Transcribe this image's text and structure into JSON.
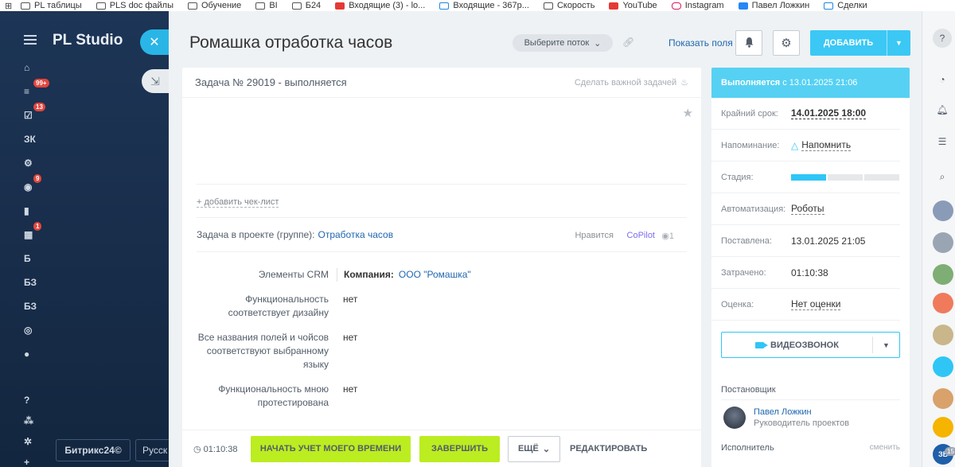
{
  "bookmarks": [
    {
      "label": "PL таблицы",
      "icon": "folder-icon"
    },
    {
      "label": "PLS doc файлы",
      "icon": "folder-icon"
    },
    {
      "label": "Обучение",
      "icon": "folder-icon"
    },
    {
      "label": "BI",
      "icon": "folder-icon"
    },
    {
      "label": "Б24",
      "icon": "folder-icon"
    },
    {
      "label": "Входящие (3) - lo...",
      "icon": "gmail-icon"
    },
    {
      "label": "Входящие - 367p...",
      "icon": "mail-icon"
    },
    {
      "label": "Скорость",
      "icon": "folder-icon"
    },
    {
      "label": "YouTube",
      "icon": "youtube-icon"
    },
    {
      "label": "Instagram",
      "icon": "instagram-icon"
    },
    {
      "label": "Павел Ложкин",
      "icon": "vk-icon"
    },
    {
      "label": "Сделки",
      "icon": "bitrix-icon"
    }
  ],
  "sidebar": {
    "brand": "PL Studio",
    "rail": [
      {
        "label": "",
        "icon": "home-icon"
      },
      {
        "label": "",
        "icon": "filter-icon",
        "badge": "99+"
      },
      {
        "label": "",
        "icon": "tasks-icon",
        "badge": "13"
      },
      {
        "label": "ЗК",
        "icon": ""
      },
      {
        "label": "",
        "icon": "crm-icon"
      },
      {
        "label": "",
        "icon": "robot-icon",
        "badge": "9"
      },
      {
        "label": "",
        "icon": "analytics-icon"
      },
      {
        "label": "",
        "icon": "store-icon",
        "badge": "1"
      },
      {
        "label": "Б",
        "icon": ""
      },
      {
        "label": "БЗ",
        "icon": ""
      },
      {
        "label": "БЗ",
        "icon": ""
      },
      {
        "label": "",
        "icon": "shield-icon"
      },
      {
        "label": "",
        "icon": "check-circle-icon"
      },
      {
        "label": "",
        "icon": ""
      },
      {
        "label": "",
        "icon": "help-icon"
      },
      {
        "label": "",
        "icon": "sitemap-icon"
      },
      {
        "label": "",
        "icon": "settings-icon"
      },
      {
        "label": "",
        "icon": "plus-icon"
      }
    ],
    "bitrix_label": "Битрикс24",
    "lang_label": "Русск"
  },
  "header": {
    "title": "Ромашка отработка часов",
    "flow_select": "Выберите поток",
    "show_fields": "Показать поля",
    "add_label": "ДОБАВИТЬ"
  },
  "task": {
    "title": "Задача № 29019 - выполняется",
    "important": "Сделать важной задачей",
    "checklist": "+ добавить чек-лист",
    "project_label": "Задача в проекте (группе):",
    "project_link": "Отработка часов",
    "likes": "Нравится",
    "copilot": "CoPilot",
    "views": "1"
  },
  "fields": [
    {
      "label": "Элементы CRM",
      "value_prefix": "Компания:",
      "value": "ООО \"Ромашка\""
    },
    {
      "label": "Функциональность соответствует дизайну",
      "value": "нет"
    },
    {
      "label": "Все названия полей и чойсов соответствуют выбранному языку",
      "value": "нет"
    },
    {
      "label": "Функциональность мною протестирована",
      "value": "нет"
    }
  ],
  "bottombar": {
    "timer": "01:10:38",
    "start": "НАЧАТЬ УЧЕТ МОЕГО ВРЕМЕНИ",
    "finish": "ЗАВЕРШИТЬ",
    "more": "ЕЩЁ",
    "edit": "РЕДАКТИРОВАТЬ"
  },
  "info": {
    "status": "Выполняется",
    "status_since": "с 13.01.2025 21:06",
    "rows": [
      {
        "label": "Крайний срок:",
        "value": "14.01.2025 18:00"
      },
      {
        "label": "Напоминание:",
        "value": "Напомнить"
      },
      {
        "label": "Стадия:",
        "value": ""
      },
      {
        "label": "Автоматизация:",
        "value": "Роботы"
      },
      {
        "label": "Поставлена:",
        "value": "13.01.2025 21:05"
      },
      {
        "label": "Затрачено:",
        "value": "01:10:38"
      },
      {
        "label": "Оценка:",
        "value": "Нет оценки"
      }
    ],
    "stage_progress": 0.33,
    "video": "ВИДЕОЗВОНОК",
    "creator_head": "Постановщик",
    "creator_name": "Павел Ложкин",
    "creator_role": "Руководитель проектов",
    "executor_head": "Исполнитель",
    "change": "сменить"
  },
  "apprail": {
    "badge": "15",
    "avatar_label": "ЗБ"
  },
  "colors": {
    "accent": "#3bc8f5",
    "green": "#bbed21",
    "link": "#2067b0",
    "badge": "#e3463d"
  }
}
